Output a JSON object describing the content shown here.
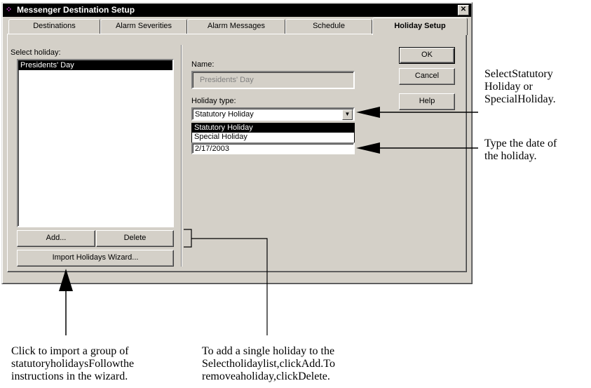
{
  "window": {
    "title": "Messenger Destination Setup",
    "close_glyph": "✕"
  },
  "tabs": [
    {
      "label": "Destinations"
    },
    {
      "label": "Alarm Severities"
    },
    {
      "label": "Alarm Messages"
    },
    {
      "label": "Schedule"
    },
    {
      "label": "Holiday Setup",
      "active": true
    }
  ],
  "left": {
    "select_label": "Select holiday:",
    "items": [
      "Presidents' Day"
    ],
    "add_label": "Add...",
    "delete_label": "Delete",
    "import_label": "Import Holidays Wizard..."
  },
  "form": {
    "name_label": "Name:",
    "name_value": "Presidents' Day",
    "type_label": "Holiday type:",
    "type_value": "Statutory Holiday",
    "type_options": [
      "Statutory Holiday",
      "Special Holiday"
    ],
    "date_value": "2/17/2003"
  },
  "buttons": {
    "ok": "OK",
    "cancel": "Cancel",
    "help": "Help"
  },
  "callouts": {
    "type_lines": [
      "SelectStatutory",
      "Holiday or",
      "SpecialHoliday."
    ],
    "date_lines": [
      "Type the date of",
      "the holiday."
    ],
    "import_lines": [
      "Click to import a group of",
      "statutoryholidaysFollowthe",
      "instructions in the wizard."
    ],
    "add_lines": [
      "To add a single holiday to the",
      "Selectholidaylist,clickAdd.To",
      "removeaholiday,clickDelete."
    ]
  }
}
